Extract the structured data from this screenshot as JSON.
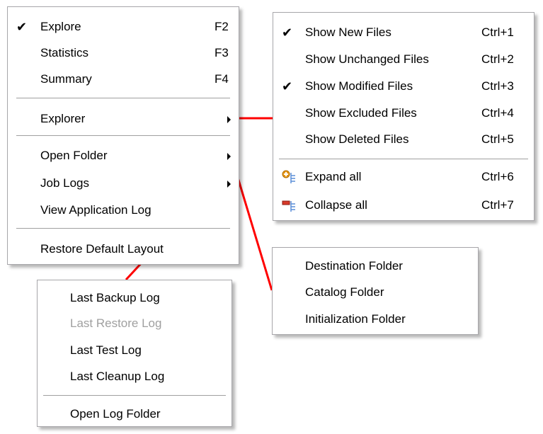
{
  "main_menu": {
    "items": [
      {
        "label": "Explore",
        "shortcut": "F2",
        "checked": true
      },
      {
        "label": "Statistics",
        "shortcut": "F3"
      },
      {
        "label": "Summary",
        "shortcut": "F4"
      },
      {
        "label": "Explorer",
        "submenu": true
      },
      {
        "label": "Open Folder",
        "submenu": true
      },
      {
        "label": "Job Logs",
        "submenu": true
      },
      {
        "label": "View Application Log"
      },
      {
        "label": "Restore Default Layout"
      }
    ]
  },
  "explorer_submenu": {
    "items": [
      {
        "label": "Show New Files",
        "shortcut": "Ctrl+1",
        "checked": true
      },
      {
        "label": "Show Unchanged Files",
        "shortcut": "Ctrl+2"
      },
      {
        "label": "Show Modified Files",
        "shortcut": "Ctrl+3",
        "checked": true
      },
      {
        "label": "Show Excluded Files",
        "shortcut": "Ctrl+4"
      },
      {
        "label": "Show Deleted Files",
        "shortcut": "Ctrl+5"
      },
      {
        "label": "Expand all",
        "shortcut": "Ctrl+6",
        "icon": "expand-all-icon"
      },
      {
        "label": "Collapse all",
        "shortcut": "Ctrl+7",
        "icon": "collapse-all-icon"
      }
    ]
  },
  "open_folder_submenu": {
    "items": [
      {
        "label": "Destination Folder"
      },
      {
        "label": "Catalog Folder"
      },
      {
        "label": "Initialization Folder"
      }
    ]
  },
  "job_logs_submenu": {
    "items": [
      {
        "label": "Last Backup Log"
      },
      {
        "label": "Last Restore Log",
        "disabled": true
      },
      {
        "label": "Last Test Log"
      },
      {
        "label": "Last Cleanup Log"
      },
      {
        "label": "Open Log Folder"
      }
    ]
  },
  "check_glyph": "✔",
  "colors": {
    "connector": "#ff0000",
    "disabled_text": "#a0a0a0",
    "menu_border": "#a7a6aa",
    "expand_icon": "#e89a1a",
    "collapse_icon": "#d83a2a",
    "tree_lines": "#5b8fd8"
  }
}
